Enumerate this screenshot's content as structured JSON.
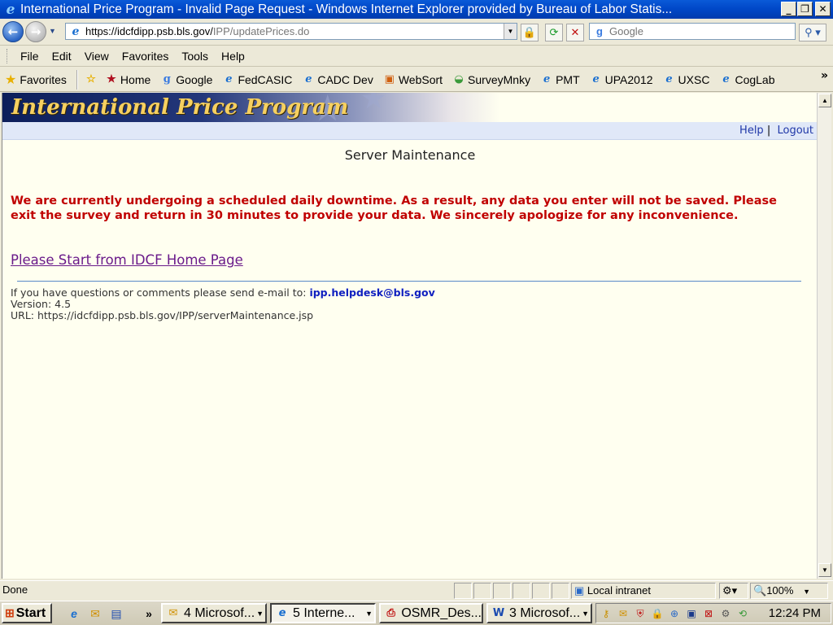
{
  "window": {
    "title": "International Price Program - Invalid Page Request - Windows Internet Explorer provided by Bureau of Labor Statis..."
  },
  "address": {
    "url_host": "https://idcfdipp.psb.bls.gov/",
    "url_path": "IPP/updatePrices.do",
    "search_placeholder": "Google"
  },
  "menu": {
    "items": [
      "File",
      "Edit",
      "View",
      "Favorites",
      "Tools",
      "Help"
    ]
  },
  "favorites": {
    "label": "Favorites",
    "links": [
      "Home",
      "Google",
      "FedCASIC",
      "CADC Dev",
      "WebSort",
      "SurveyMnky",
      "PMT",
      "UPA2012",
      "UXSC",
      "CogLab"
    ]
  },
  "page": {
    "program_title": "International Price Program",
    "help_link": "Help",
    "separator": "|",
    "logout_link": "Logout",
    "heading": "Server Maintenance",
    "alert": "We are currently undergoing a scheduled daily downtime. As a result, any data you enter will not be saved. Please exit the survey and return in 30 minutes to provide your data. We sincerely apologize for any inconvenience.",
    "home_link": "Please Start from IDCF Home Page",
    "contact_text": "If you have questions or comments please send e-mail to:",
    "contact_email": "ipp.helpdesk@bls.gov",
    "version": "Version: 4.5",
    "url_line": "URL: https://idcfdipp.psb.bls.gov/IPP/serverMaintenance.jsp"
  },
  "status": {
    "text": "Done",
    "zone": "Local intranet",
    "zoom": "100%"
  },
  "taskbar": {
    "start": "Start",
    "tasks": [
      "4 Microsof...",
      "5 Interne...",
      "OSMR_Des...",
      "3 Microsof..."
    ],
    "clock": "12:24 PM"
  },
  "colors": {
    "alert": "#c00000",
    "visited_link": "#6a1a8a",
    "email": "#1020c0",
    "page_bg": "#fffff0"
  }
}
